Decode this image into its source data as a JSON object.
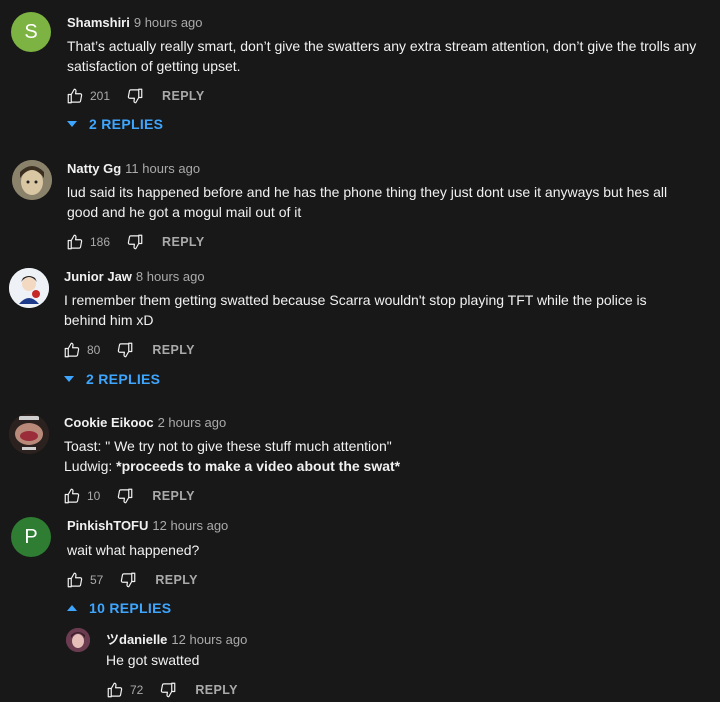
{
  "comments": [
    {
      "avatar_letter": "S",
      "avatar_color": "#7cb342",
      "author": "Shamshiri",
      "time": "9 hours ago",
      "text": "That’s actually really smart, don’t give the swatters any extra stream attention, don’t give the trolls any satisfaction of getting upset.",
      "likes": "201",
      "reply_label": "REPLY",
      "replies_label": "2 REPLIES"
    },
    {
      "author": "Natty Gg",
      "time": "11 hours ago",
      "text": "lud said its happened before and he has the phone thing they just dont use it anyways but hes all good and he got a mogul mail out of it",
      "likes": "186",
      "reply_label": "REPLY"
    },
    {
      "author": "Junior Jaw",
      "time": "8 hours ago",
      "text": "I remember them getting swatted because Scarra wouldn't stop playing TFT while the police is behind him xD",
      "likes": "80",
      "reply_label": "REPLY",
      "replies_label": "2 REPLIES"
    },
    {
      "author": "Cookie Eikooc",
      "time": "2 hours ago",
      "line1": "Toast: \" We try not to give these stuff much attention\"",
      "line2_prefix": "Ludwig: ",
      "line2_bold": "*proceeds to make a video about the swat*",
      "likes": "10",
      "reply_label": "REPLY"
    },
    {
      "avatar_letter": "P",
      "avatar_color": "#2e7d32",
      "author": "PinkishTOFU",
      "time": "12 hours ago",
      "text": "wait what happened?",
      "likes": "57",
      "reply_label": "REPLY",
      "replies_label": "10 REPLIES"
    }
  ],
  "reply": {
    "author": "ツdanielle",
    "time": "12 hours ago",
    "text": "He got swatted",
    "likes": "72",
    "reply_label": "REPLY"
  },
  "colors": {
    "background": "#181818",
    "link_blue": "#3ea6ff",
    "secondary_text": "#aaaaaa"
  },
  "icons": {
    "like": "thumb-up-icon",
    "dislike": "thumb-down-icon",
    "expand": "triangle-down-icon",
    "collapse": "triangle-up-icon"
  }
}
